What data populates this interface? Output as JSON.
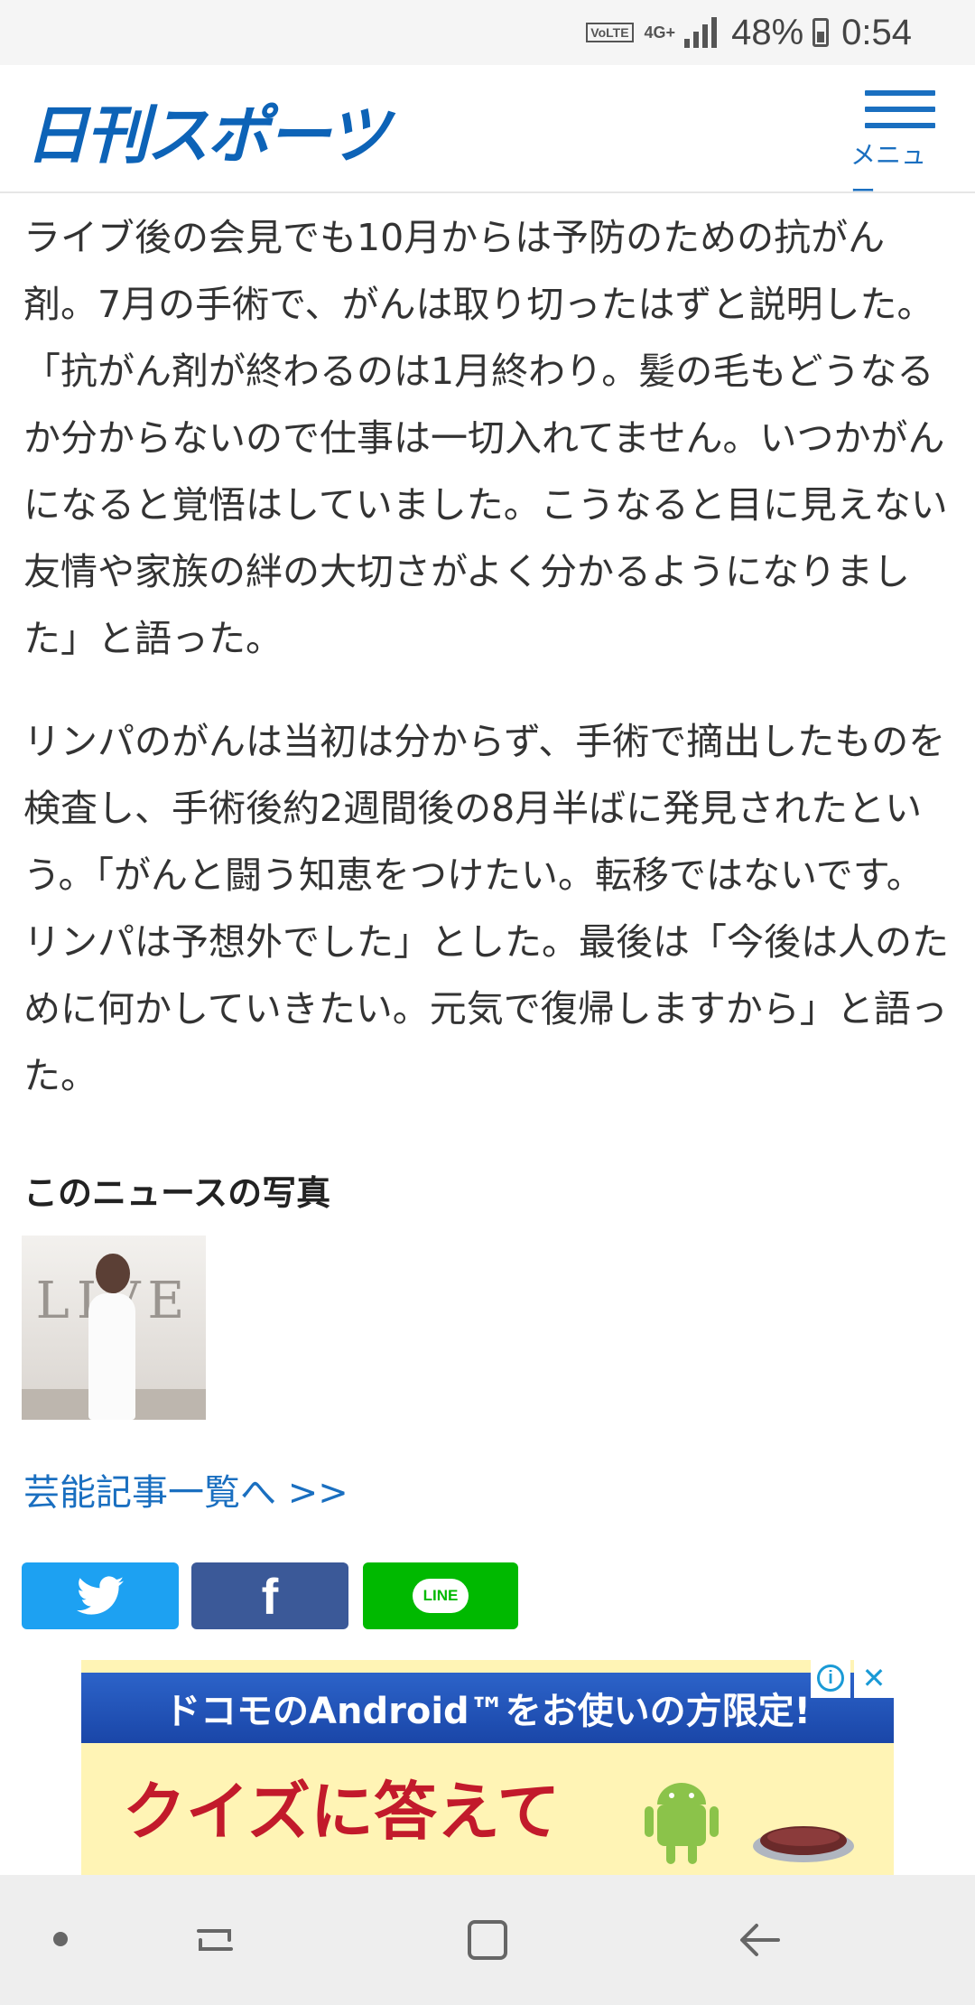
{
  "status_bar": {
    "volte": "VoLTE",
    "network": "4G+",
    "battery_percent": "48%",
    "time": "0:54"
  },
  "header": {
    "logo_text": "日刊スポーツ",
    "menu_label": "メニュー"
  },
  "article": {
    "paragraph1": "ライブ後の会見でも10月からは予防のための抗がん剤。7月の手術で、がんは取り切ったはずと説明した。「抗がん剤が終わるのは1月終わり。髪の毛もどうなるか分からないので仕事は一切入れてません。いつかがんになると覚悟はしていました。こうなると目に見えない友情や家族の絆の大切さがよく分かるようになりました」と語った。",
    "paragraph2": "リンパのがんは当初は分からず、手術で摘出したものを検査し、手術後約2週間後の8月半ばに発見されたという。「がんと闘う知恵をつけたい。転移ではないです。リンパは予想外でした」とした。最後は「今後は人のために何かしていきたい。元気で復帰しますから」と語った。"
  },
  "photos": {
    "heading": "このニュースの写真",
    "thumb_letters": "LIVE"
  },
  "links": {
    "entertainment_list": "芸能記事一覧へ >>"
  },
  "share": {
    "twitter_icon": "twitter-bird-icon",
    "facebook_glyph": "f",
    "line_label": "LINE"
  },
  "ad": {
    "banner_text": "ドコモのAndroid™をお使いの方限定!",
    "headline": "クイズに答えて",
    "info_glyph": "i",
    "close_glyph": "✕"
  },
  "colors": {
    "brand_blue": "#0d63b7",
    "link_blue": "#1a6fc0",
    "twitter": "#1da1f2",
    "facebook": "#3b5998",
    "line": "#00b900"
  }
}
